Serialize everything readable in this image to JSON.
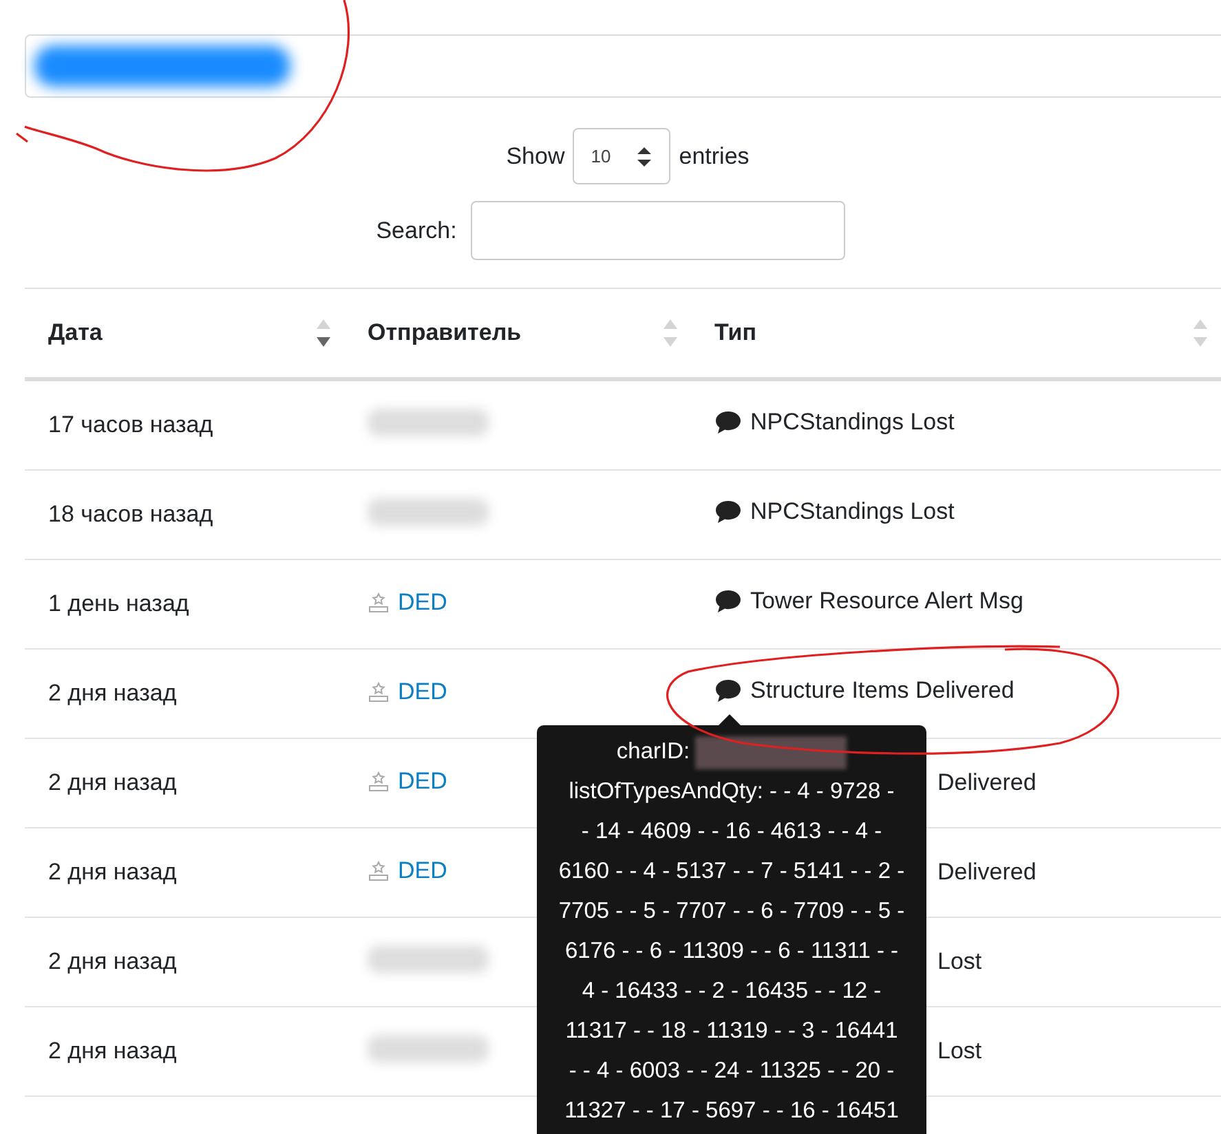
{
  "header": {
    "title_redacted": true
  },
  "length_control": {
    "label_before": "Show",
    "value": "10",
    "label_after": "entries"
  },
  "search": {
    "label": "Search:"
  },
  "table": {
    "columns": [
      {
        "label": "Дата",
        "sorted": true
      },
      {
        "label": "Отправитель",
        "sorted": false
      },
      {
        "label": "Тип",
        "sorted": false
      }
    ],
    "rows": [
      {
        "date": "17 часов назад",
        "sender": {
          "kind": "redacted"
        },
        "type": "NPCStandings Lost"
      },
      {
        "date": "18 часов назад",
        "sender": {
          "kind": "redacted"
        },
        "type": "NPCStandings Lost"
      },
      {
        "date": "1 день назад",
        "sender": {
          "kind": "link",
          "text": "DED"
        },
        "type": "Tower Resource Alert Msg"
      },
      {
        "date": "2 дня назад",
        "sender": {
          "kind": "link",
          "text": "DED"
        },
        "type": "Structure Items Delivered"
      },
      {
        "date": "2 дня назад",
        "sender": {
          "kind": "link",
          "text": "DED"
        },
        "type": "Delivered",
        "covered": true
      },
      {
        "date": "2 дня назад",
        "sender": {
          "kind": "link",
          "text": "DED"
        },
        "type": "Delivered",
        "covered": true
      },
      {
        "date": "2 дня назад",
        "sender": {
          "kind": "redacted"
        },
        "type": "Lost",
        "covered": true
      },
      {
        "date": "2 дня назад",
        "sender": {
          "kind": "redacted"
        },
        "type": "Lost",
        "covered": true
      }
    ]
  },
  "tooltip": {
    "char_id_label": "charID:",
    "lines": [
      "listOfTypesAndQty: - - 4 - 9728 -",
      "- 14 - 4609 - - 16 - 4613 - - 4 -",
      "6160 - - 4 - 5137 - - 7 - 5141 - - 2 -",
      "7705 - - 5 - 7707 - - 6 - 7709 - - 5 -",
      "6176 - - 6 - 11309 - - 6 - 11311 - -",
      "4 - 16433 - - 2 - 16435 - - 12 -",
      "11317 - - 18 - 11319 - - 3 - 16441",
      "- - 4 - 6003 - - 24 - 11325 - - 20 -",
      "11327 - - 17 - 5697 - - 16 - 16451"
    ]
  }
}
